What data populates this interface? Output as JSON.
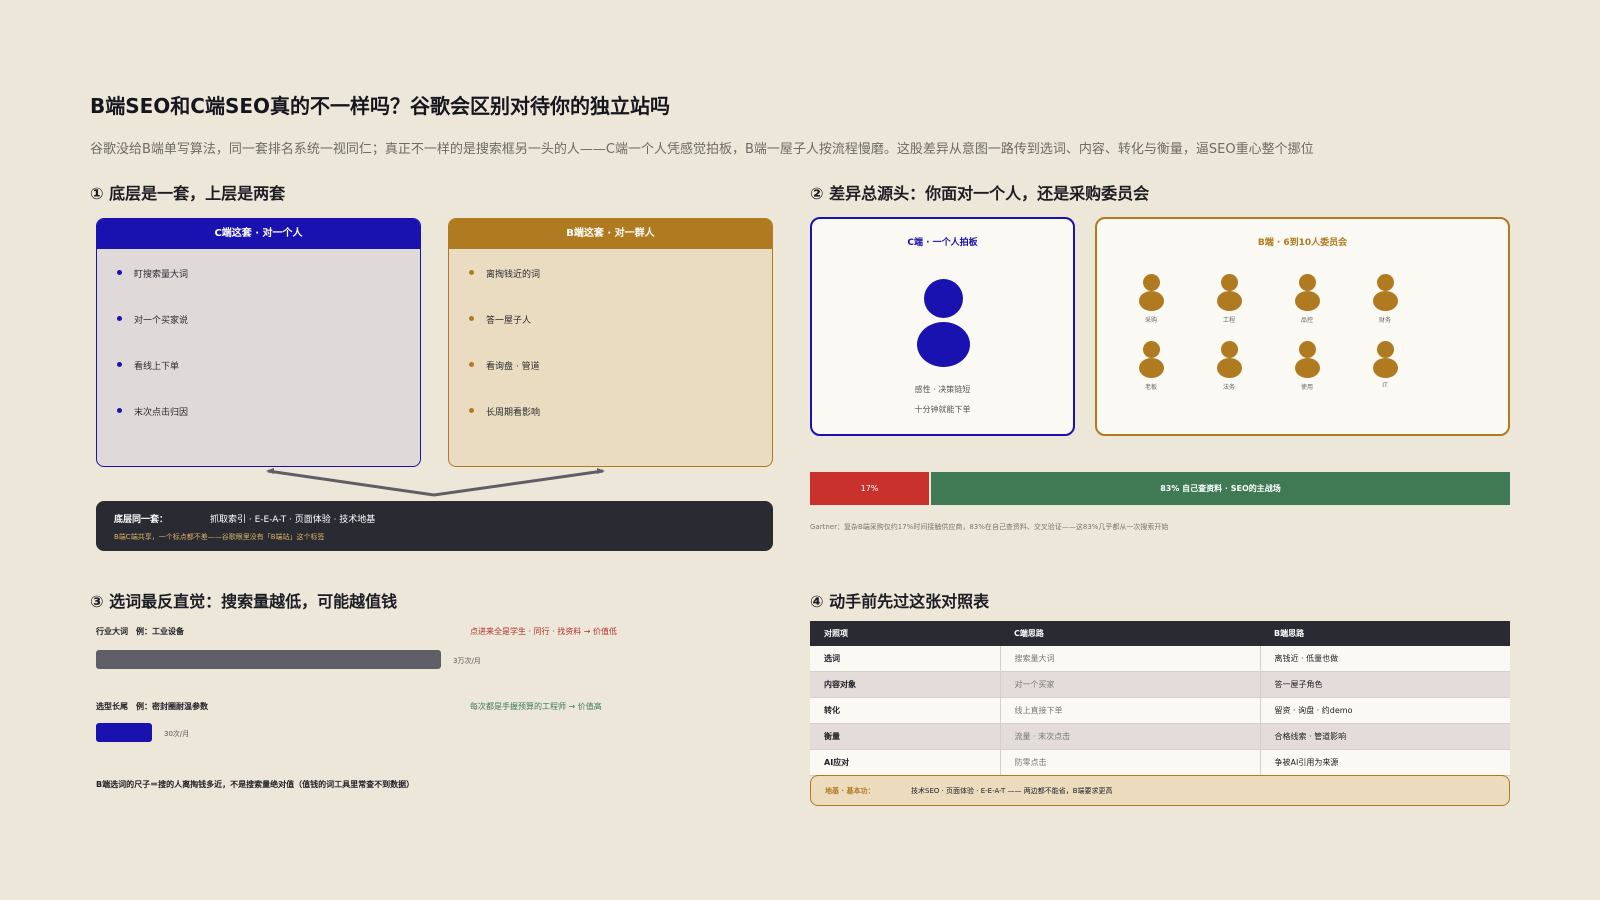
{
  "header": {
    "title": "B端SEO和C端SEO真的不一样吗？谷歌会区别对待你的独立站吗",
    "subtitle": "谷歌没给B端单写算法，同一套排名系统一视同仁；真正不一样的是搜索框另一头的人——C端一个人凭感觉拍板，B端一屋子人按流程慢磨。这股差异从意图一路传到选词、内容、转化与衡量，逼SEO重心整个挪位"
  },
  "section1": {
    "title": "① 底层是一套，上层是两套",
    "c_card": {
      "header": "C端这套 · 对一个人",
      "items": [
        "盯搜索量大词",
        "对一个买家说",
        "看线上下单",
        "末次点击归因"
      ]
    },
    "b_card": {
      "header": "B端这套 · 对一群人",
      "items": [
        "离掏钱近的词",
        "答一屋子人",
        "看询盘 · 管道",
        "长周期看影响"
      ]
    },
    "base": {
      "label": "底层同一套：",
      "value": "抓取索引 · E-E-A-T · 页面体验 · 技术地基",
      "note": "B端C端共享，一个标点都不差——谷歌眼里没有「B端站」这个标签"
    }
  },
  "section2": {
    "title": "② 差异总源头：你面对一个人，还是采购委员会",
    "c_card": {
      "header": "C端 · 一个人拍板",
      "caption1": "感性 · 决策链短",
      "caption2": "十分钟就能下单"
    },
    "b_card": {
      "header": "B端 · 6到10人委员会",
      "roles": [
        "采购",
        "工程",
        "品控",
        "财务",
        "老板",
        "法务",
        "使用",
        "IT"
      ]
    },
    "share": {
      "left_pct": 17,
      "left_label": "17%",
      "right_pct": 83,
      "right_label": "83% 自己查资料 · SEO的主战场"
    },
    "source": "Gartner：复杂B端采购仅约17%时间接触供应商，83%在自己查资料、交叉验证——这83%几乎都从一次搜索开始"
  },
  "section3": {
    "title": "③ 选词最反直觉：搜索量越低，可能越值钱",
    "head_kw": {
      "label": "行业大词　例：工业设备",
      "note": "点进来全是学生 · 同行 · 找资料 → 价值低",
      "volume": 30000,
      "volume_label": "3万次/月"
    },
    "long_kw": {
      "label": "选型长尾　例：密封圈耐温参数",
      "note": "每次都是手握预算的工程师 → 价值高",
      "volume": 30,
      "volume_label": "30次/月"
    },
    "footer": "B端选词的尺子＝搜的人离掏钱多近，不是搜索量绝对值（值钱的词工具里常查不到数据）"
  },
  "section4": {
    "title": "④ 动手前先过这张对照表",
    "columns": [
      "对照项",
      "C端思路",
      "B端思路"
    ],
    "rows": [
      [
        "选词",
        "搜索量大词",
        "离钱近 · 低量也做"
      ],
      [
        "内容对象",
        "对一个买家",
        "答一屋子角色"
      ],
      [
        "转化",
        "线上直接下单",
        "留资 · 询盘 · 约demo"
      ],
      [
        "衡量",
        "流量 · 末次点击",
        "合格线索 · 管道影响"
      ],
      [
        "AI应对",
        "防零点击",
        "争被AI引用为来源"
      ]
    ],
    "foundation": {
      "label": "地基 · 基本功：",
      "value": "技术SEO · 页面体验 · E-E-A-T —— 两边都不能省，B端要求更高"
    }
  },
  "colors": {
    "c_blue": "#1a12b0",
    "b_gold": "#b07a20",
    "dark": "#2a2a33",
    "red": "#c9312c",
    "green": "#3f7a55",
    "bar_gray": "#5f5e66"
  }
}
